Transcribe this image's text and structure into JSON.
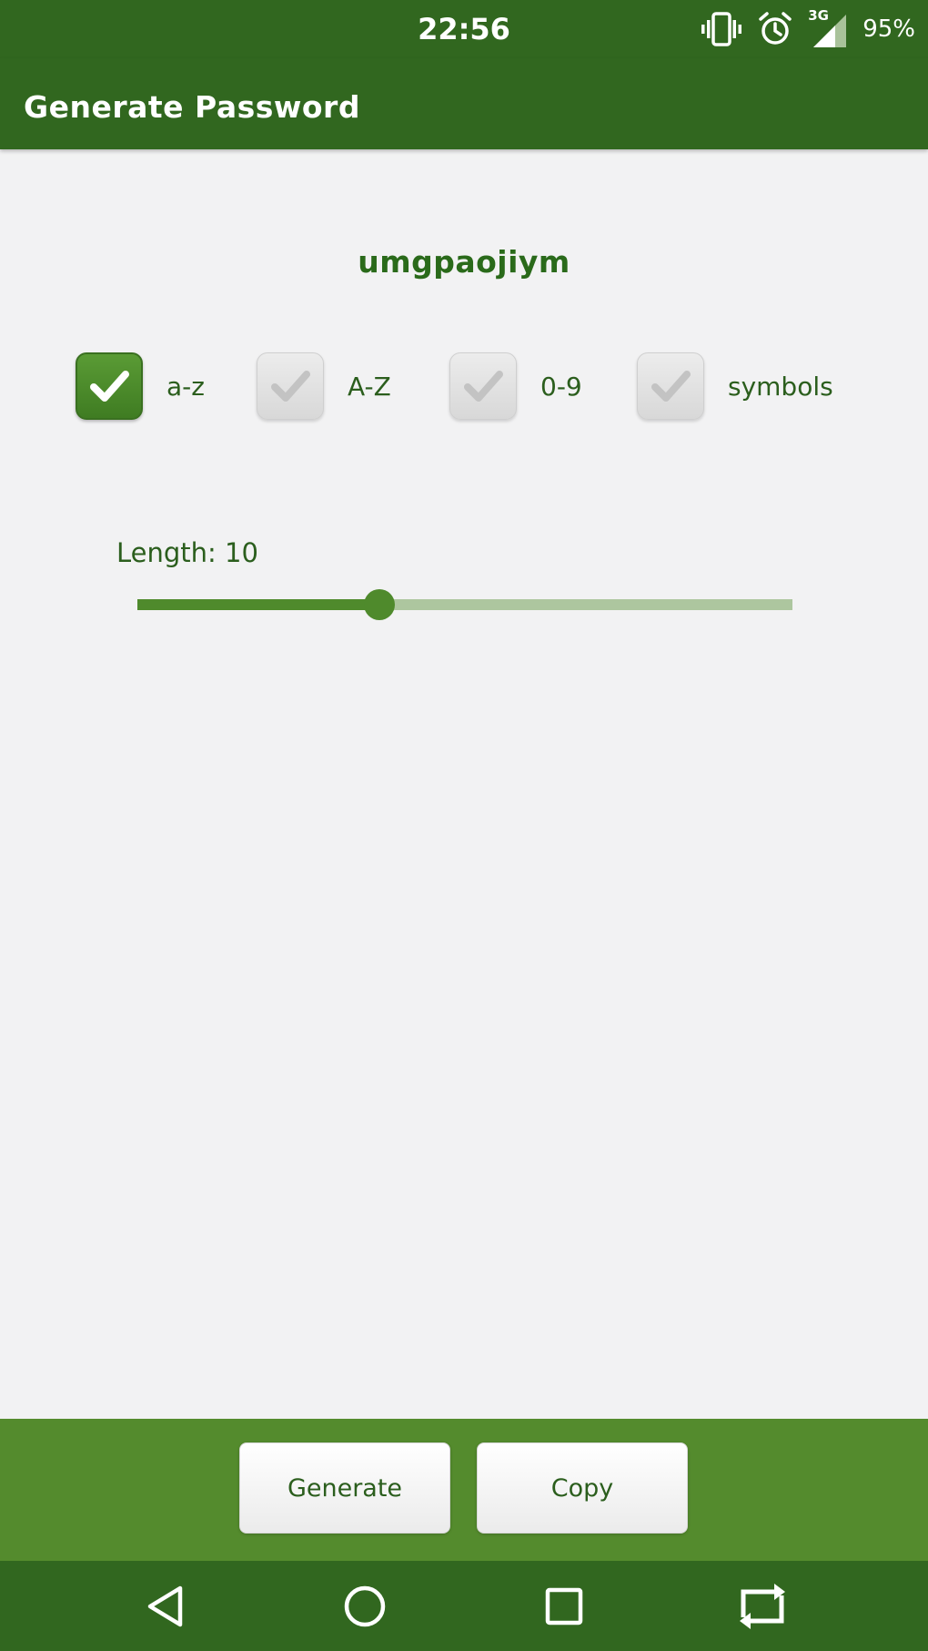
{
  "status_bar": {
    "time": "22:56",
    "network": "3G",
    "battery": "95%",
    "icons": [
      "vibrate-icon",
      "alarm-icon",
      "signal-icon"
    ]
  },
  "app_bar": {
    "title": "Generate Password"
  },
  "password": {
    "value": "umgpaojiym"
  },
  "options": [
    {
      "label": "a-z",
      "checked": true
    },
    {
      "label": "A-Z",
      "checked": false
    },
    {
      "label": "0-9",
      "checked": false
    },
    {
      "label": "symbols",
      "checked": false
    }
  ],
  "length": {
    "label": "Length:",
    "value": "10",
    "slider_fraction": 0.37
  },
  "buttons": {
    "generate": "Generate",
    "copy": "Copy"
  },
  "nav_bar": {
    "icons": [
      "back-icon",
      "home-icon",
      "recents-icon",
      "rotate-icon"
    ]
  },
  "colors": {
    "primary_dark": "#31671f",
    "primary": "#548b2d",
    "accent": "#4f8a2c",
    "background": "#f2f2f3",
    "text": "#2b5e1d"
  }
}
